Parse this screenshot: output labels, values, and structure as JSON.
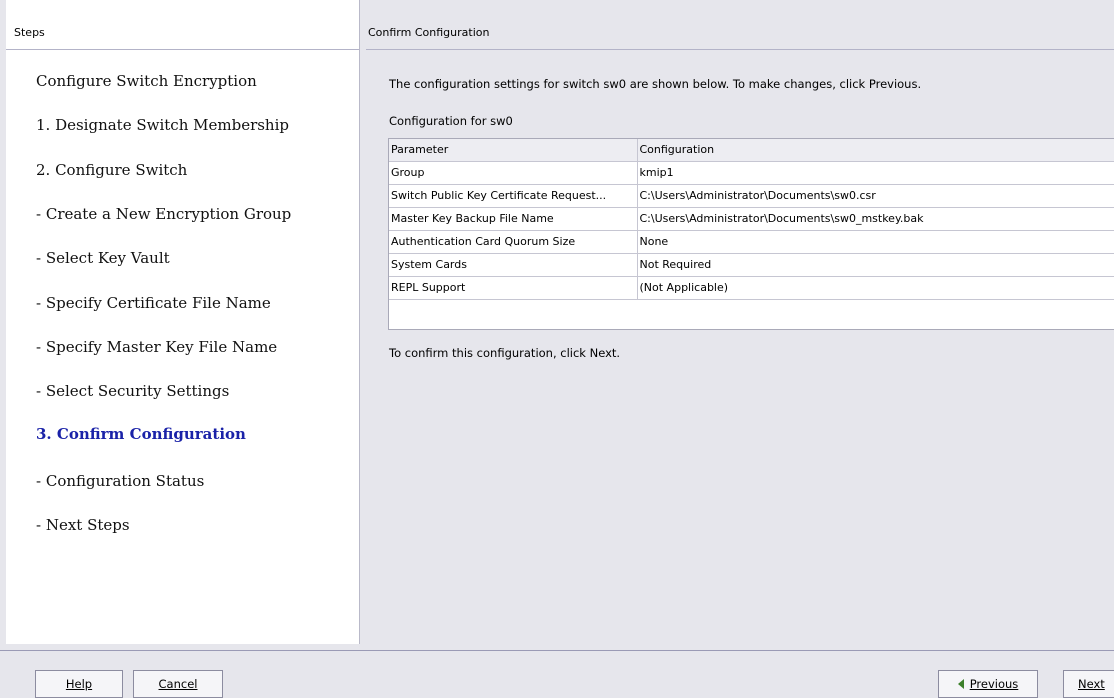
{
  "left_panel": {
    "header": "Steps",
    "steps": [
      {
        "label": "Configure Switch Encryption",
        "active": false
      },
      {
        "label": "1. Designate Switch Membership",
        "active": false
      },
      {
        "label": "2. Configure Switch",
        "active": false
      },
      {
        "label": "- Create a New Encryption Group",
        "active": false
      },
      {
        "label": "- Select Key Vault",
        "active": false
      },
      {
        "label": "- Specify Certificate File Name",
        "active": false
      },
      {
        "label": "- Specify Master Key File Name",
        "active": false
      },
      {
        "label": "- Select Security Settings",
        "active": false
      },
      {
        "label": "3. Confirm Configuration",
        "active": true
      },
      {
        "label": "- Configuration Status",
        "active": false
      },
      {
        "label": "- Next Steps",
        "active": false
      }
    ]
  },
  "right_panel": {
    "header": "Confirm Configuration",
    "intro": "The configuration settings for switch sw0 are shown below. To make changes, click Previous.",
    "config_label": "Configuration for sw0",
    "table": {
      "columns": [
        "Parameter",
        "Configuration"
      ],
      "rows": [
        [
          "Group",
          "kmip1"
        ],
        [
          "Switch Public Key Certificate Request...",
          "C:\\Users\\Administrator\\Documents\\sw0.csr"
        ],
        [
          "Master Key Backup File Name",
          "C:\\Users\\Administrator\\Documents\\sw0_mstkey.bak"
        ],
        [
          "Authentication Card Quorum Size",
          "None"
        ],
        [
          "System Cards",
          "Not Required"
        ],
        [
          "REPL Support",
          "(Not Applicable)"
        ]
      ]
    },
    "confirm_note": "To confirm this configuration, click Next."
  },
  "buttons": {
    "help": "Help",
    "cancel": "Cancel",
    "previous": "Previous",
    "next": "Next"
  },
  "colors": {
    "active_step": "#1a22a8",
    "previous_arrow": "#3b7f2a"
  }
}
